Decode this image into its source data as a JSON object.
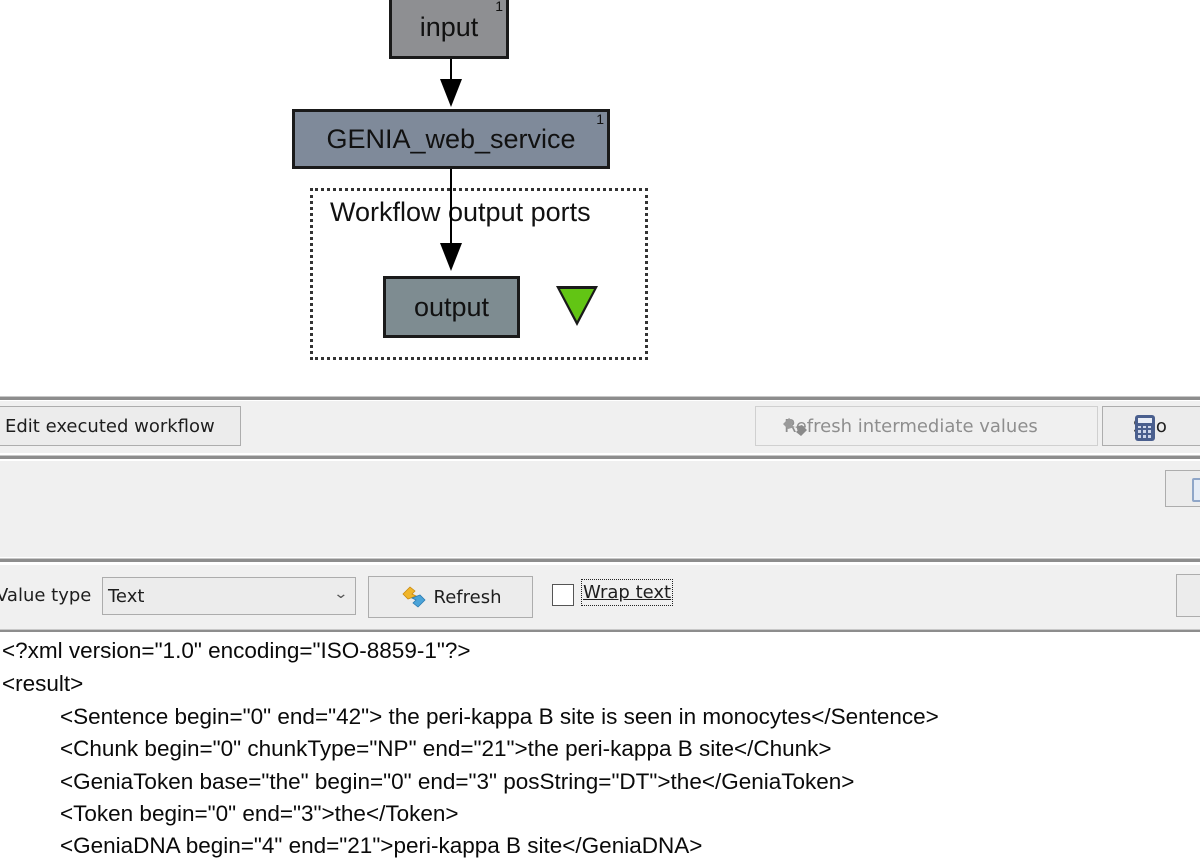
{
  "diagram": {
    "nodes": [
      {
        "id": "input",
        "label": "input",
        "badge": "1"
      },
      {
        "id": "genia",
        "label": "GENIA_web_service",
        "badge": "1"
      },
      {
        "id": "output",
        "label": "output"
      }
    ],
    "output_group_label": "Workflow output ports",
    "colors": {
      "output_port_marker": "#62c514",
      "input_node": "#8e8f92",
      "service_node": "#7f8a9a",
      "output_node": "#7e8c91"
    }
  },
  "toolbar1": {
    "edit_button": "Edit executed workflow",
    "refresh_intermediate_button": "Refresh intermediate values",
    "show_button": "Sho"
  },
  "toolbar3": {
    "value_type_label": "Value type",
    "value_type_selected": "Text",
    "refresh_button": "Refresh",
    "wrap_text_label": "Wrap text",
    "wrap_text_checked": false
  },
  "output": {
    "lines": [
      "<?xml version=\"1.0\" encoding=\"ISO-8859-1\"?>",
      "<result>",
      "<Sentence begin=\"0\" end=\"42\"> the peri-kappa B site is seen in monocytes</Sentence>",
      "<Chunk begin=\"0\" chunkType=\"NP\" end=\"21\">the peri-kappa B site</Chunk>",
      "<GeniaToken base=\"the\" begin=\"0\" end=\"3\" posString=\"DT\">the</GeniaToken>",
      "<Token begin=\"0\" end=\"3\">the</Token>",
      "<GeniaDNA begin=\"4\" end=\"21\">peri-kappa B site</GeniaDNA>"
    ]
  }
}
